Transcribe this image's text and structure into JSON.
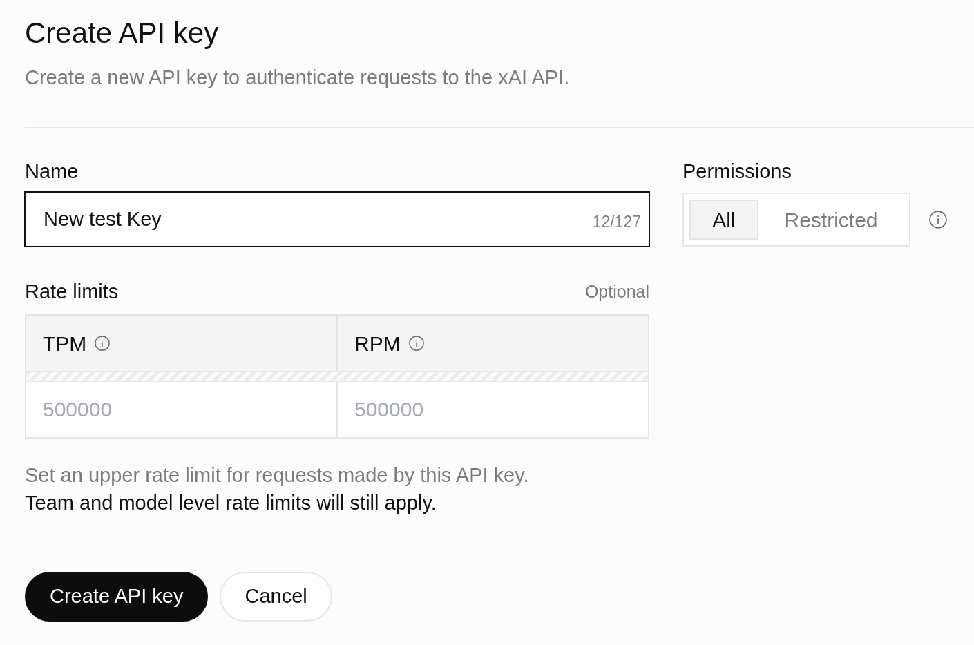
{
  "header": {
    "title": "Create API key",
    "subtitle": "Create a new API key to authenticate requests to the xAI API."
  },
  "name_field": {
    "label": "Name",
    "value": "New test Key",
    "counter": "12/127",
    "focused": true
  },
  "permissions": {
    "label": "Permissions",
    "options": [
      {
        "label": "All",
        "selected": true
      },
      {
        "label": "Restricted",
        "selected": false
      }
    ]
  },
  "rate_limits": {
    "label": "Rate limits",
    "hint": "Optional",
    "columns": [
      {
        "label": "TPM",
        "placeholder": "500000"
      },
      {
        "label": "RPM",
        "placeholder": "500000"
      }
    ],
    "help_text": "Set an upper rate limit for requests made by this API key.",
    "note": "Team and model level rate limits will still apply."
  },
  "buttons": [
    {
      "label": "Create API key",
      "kind": "primary"
    },
    {
      "label": "Cancel",
      "kind": "secondary"
    }
  ]
}
